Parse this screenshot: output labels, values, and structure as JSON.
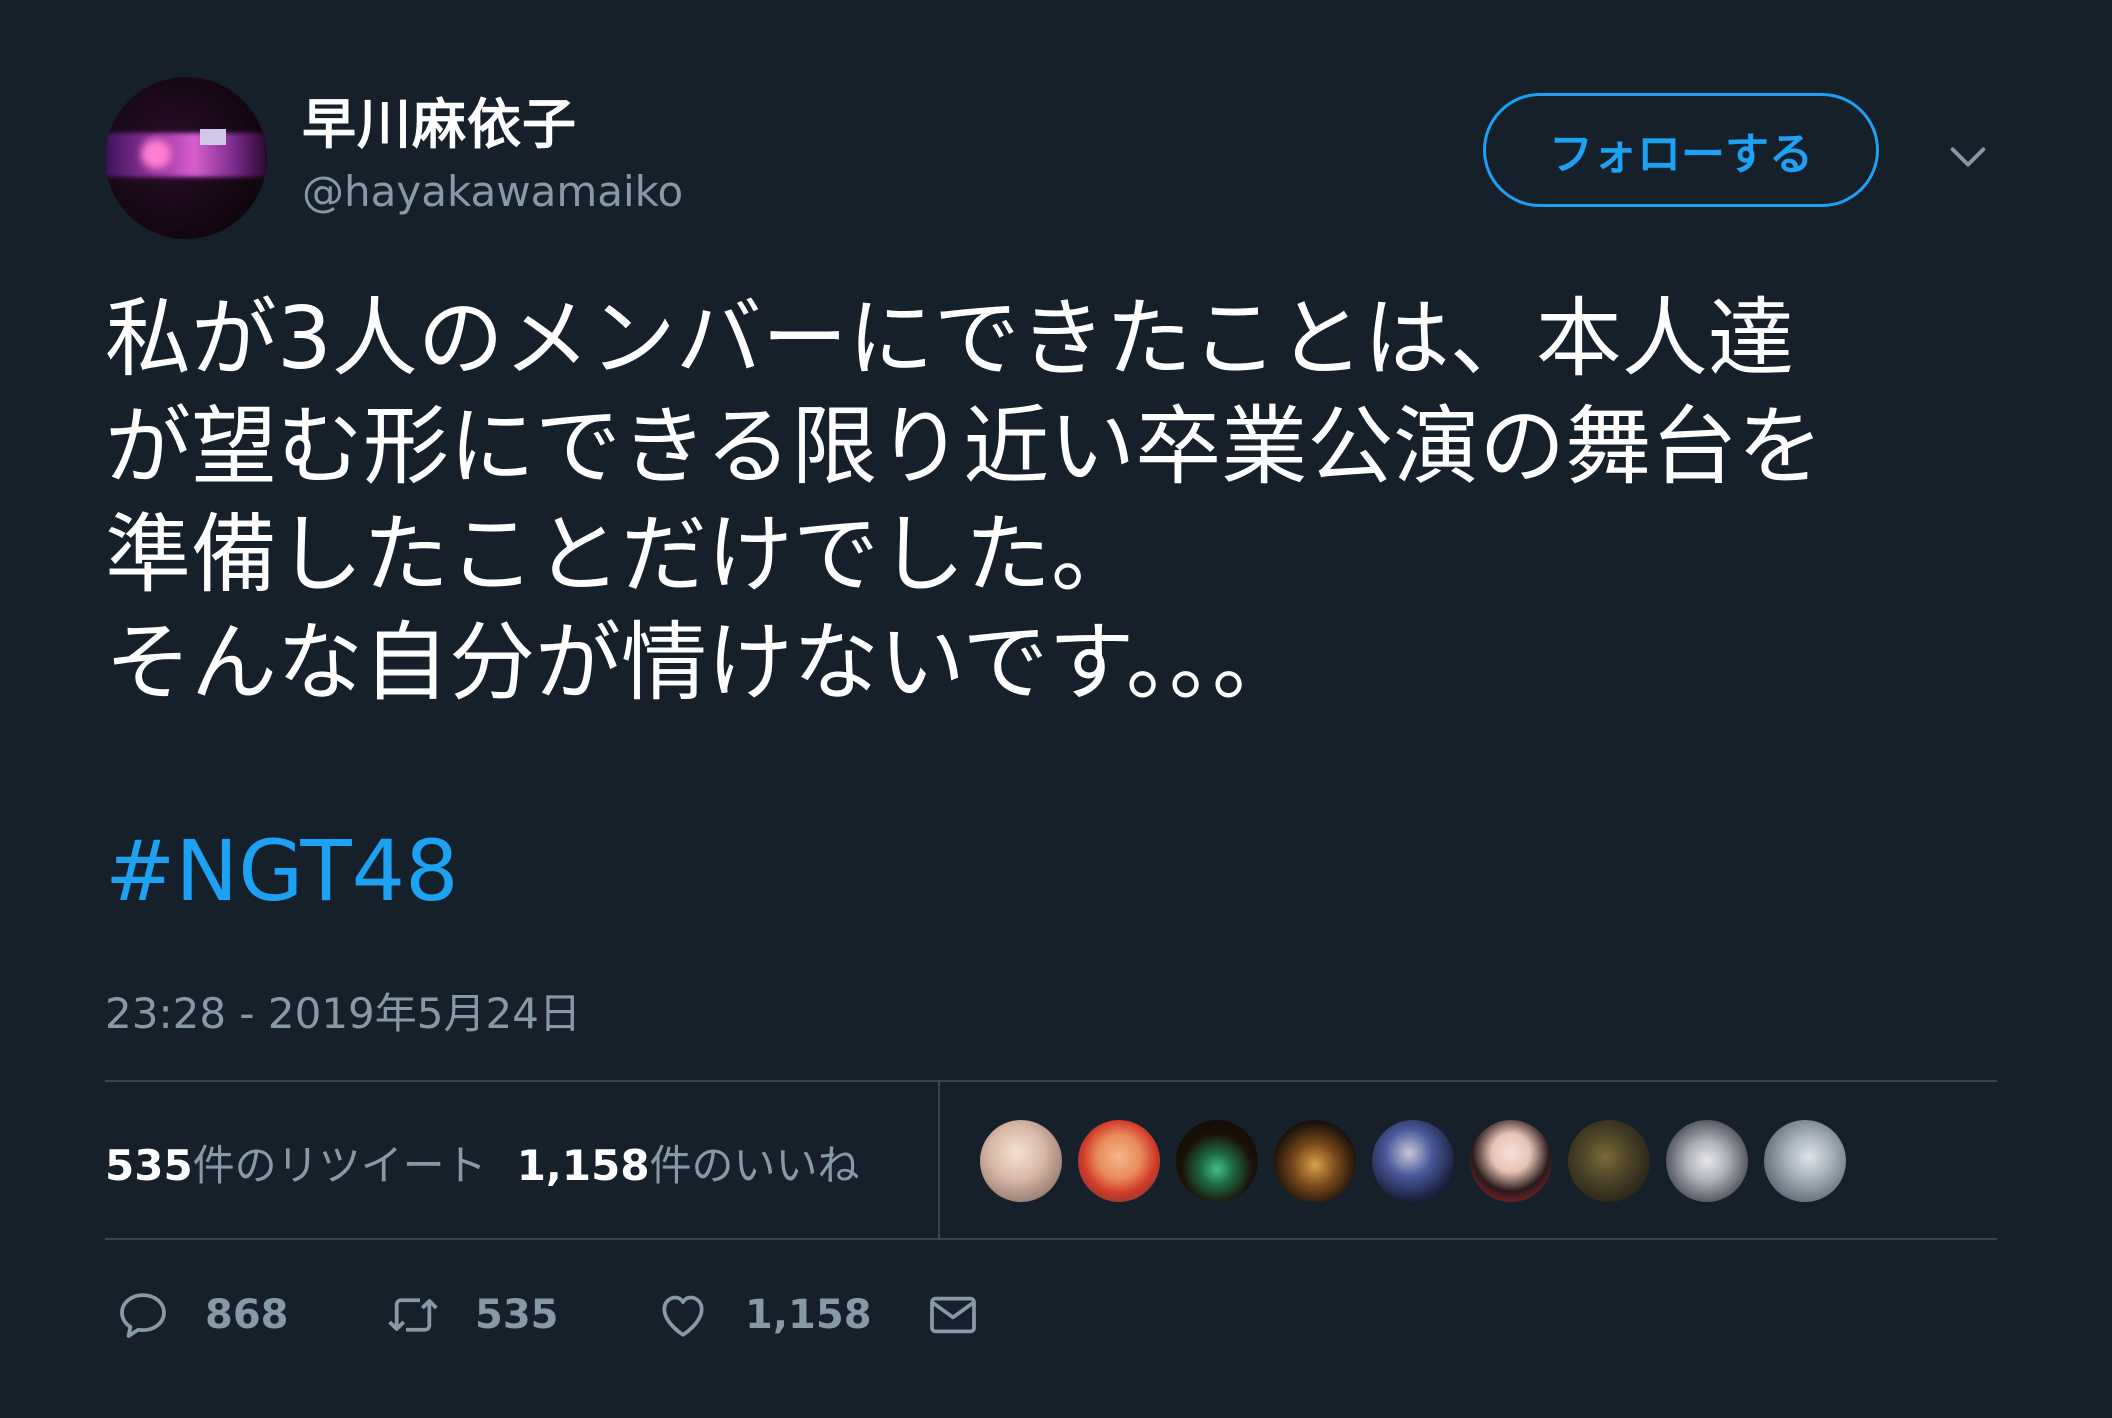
{
  "user": {
    "display_name": "早川麻依子",
    "handle": "@hayakawamaiko"
  },
  "follow_button": {
    "label": "フォローする"
  },
  "tweet": {
    "lines": [
      "私が3人のメンバーにできたことは、本人達",
      "が望む形にできる限り近い卒業公演の舞台を",
      "準備したことだけでした。",
      "そんな自分が情けないです。。。"
    ],
    "hashtag": "#NGT48",
    "timestamp": "23:28 - 2019年5月24日"
  },
  "stats": {
    "retweets_count": "535",
    "retweets_label": "件のリツイート",
    "likes_count": "1,158",
    "likes_label": "件のいいね"
  },
  "likers": [
    {
      "icon": "liker-avatar-1"
    },
    {
      "icon": "liker-avatar-2"
    },
    {
      "icon": "liker-avatar-3"
    },
    {
      "icon": "liker-avatar-4"
    },
    {
      "icon": "liker-avatar-5"
    },
    {
      "icon": "liker-avatar-6"
    },
    {
      "icon": "liker-avatar-7"
    },
    {
      "icon": "liker-avatar-8"
    },
    {
      "icon": "liker-avatar-9"
    }
  ],
  "actions": {
    "reply_count": "868",
    "retweet_count": "535",
    "like_count": "1,158"
  },
  "colors": {
    "background": "#15202b",
    "accent": "#1da1f2",
    "secondary_text": "#8899a6",
    "divider": "#38444d"
  }
}
